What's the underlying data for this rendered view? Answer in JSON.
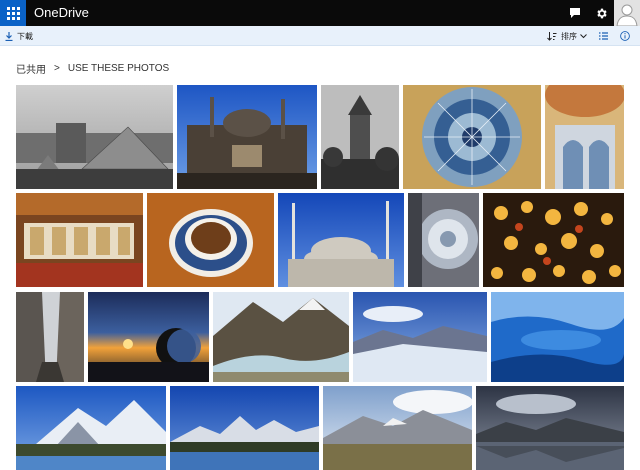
{
  "app": {
    "name": "OneDrive"
  },
  "commandbar": {
    "download_label": "下載",
    "sort_label": "排序"
  },
  "breadcrumb": {
    "root": "已共用",
    "separator": ">",
    "current": "USE THESE PHOTOS"
  },
  "colors": {
    "topbar_bg": "#0a0a0a",
    "waffle_bg": "#0a62c7",
    "commandbar_bg": "#e8f1fb",
    "accent": "#0a62c7"
  },
  "icons": {
    "waffle": "app-launcher-icon",
    "chat": "feedback-icon",
    "settings": "gear-icon",
    "avatar": "user-avatar-icon",
    "download": "download-icon",
    "sort": "sort-icon",
    "view": "list-view-icon",
    "info": "info-icon"
  },
  "photos": [
    {
      "subject": "louvre-pyramid"
    },
    {
      "subject": "mosque-courtyard"
    },
    {
      "subject": "galata-tower"
    },
    {
      "subject": "dome-interior"
    },
    {
      "subject": "palace-interior"
    },
    {
      "subject": "ottoman-room"
    },
    {
      "subject": "turkish-coffee"
    },
    {
      "subject": "blue-mosque"
    },
    {
      "subject": "mosque-dome-ceiling"
    },
    {
      "subject": "lamps-bazaar"
    },
    {
      "subject": "narrow-street"
    },
    {
      "subject": "crescent-sunset"
    },
    {
      "subject": "mountain-river"
    },
    {
      "subject": "glacier-field"
    },
    {
      "subject": "glacier-ice"
    },
    {
      "subject": "snowy-peaks-lake"
    },
    {
      "subject": "torres-peaks"
    },
    {
      "subject": "mountain-plains"
    },
    {
      "subject": "lake-reflection"
    }
  ]
}
